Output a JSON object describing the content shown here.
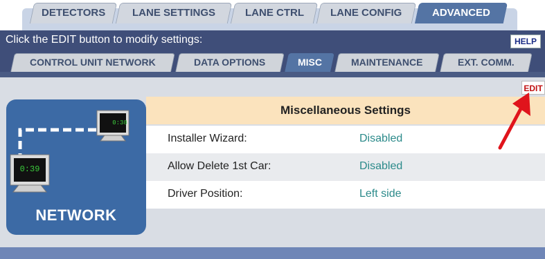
{
  "top_tabs": [
    {
      "label": "DETECTORS",
      "active": false
    },
    {
      "label": "LANE SETTINGS",
      "active": false
    },
    {
      "label": "LANE CTRL",
      "active": false
    },
    {
      "label": "LANE CONFIG",
      "active": false
    },
    {
      "label": "ADVANCED",
      "active": true
    }
  ],
  "header": {
    "instruction": "Click the EDIT button to modify settings:",
    "help_label": "HELP"
  },
  "sub_tabs": [
    {
      "label": "CONTROL UNIT NETWORK",
      "active": false
    },
    {
      "label": "DATA OPTIONS",
      "active": false
    },
    {
      "label": "MISC",
      "active": true
    },
    {
      "label": "MAINTENANCE",
      "active": false
    },
    {
      "label": "EXT. COMM.",
      "active": false
    }
  ],
  "edit_label": "EDIT",
  "network_panel": {
    "label": "NETWORK",
    "screen1_time": "0:39",
    "screen2_time": "0:38"
  },
  "settings": {
    "title": "Miscellaneous Settings",
    "rows": [
      {
        "label": "Installer Wizard:",
        "value": "Disabled"
      },
      {
        "label": "Allow Delete 1st Car:",
        "value": "Disabled"
      },
      {
        "label": "Driver Position:",
        "value": "Left side"
      }
    ]
  },
  "colors": {
    "header_bar": "#3f4e79",
    "active_tab": "#5474a4",
    "value_text": "#2b8a8a",
    "title_band": "#fbe3bd",
    "annotation_arrow": "#e0141c"
  }
}
